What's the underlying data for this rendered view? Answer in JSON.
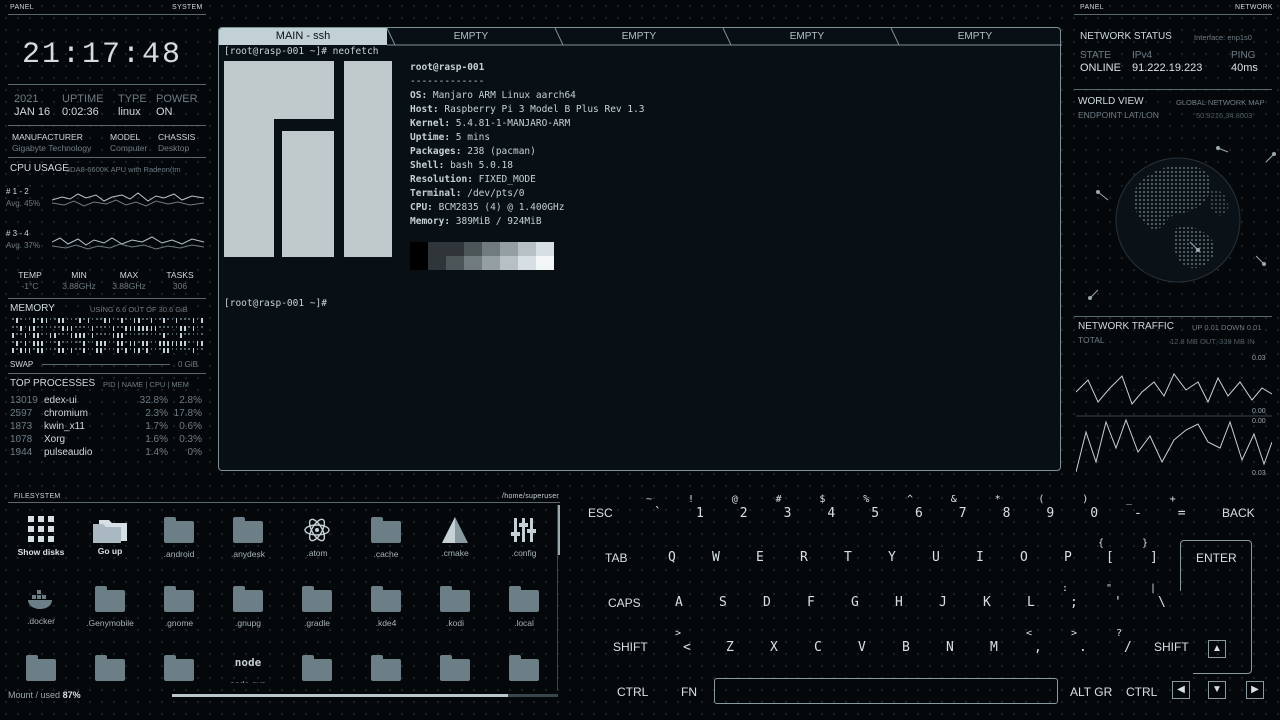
{
  "left_panel": {
    "header_left": "PANEL",
    "header_right": "SYSTEM",
    "clock": "21:17:48",
    "sysinfo": {
      "year": "2021",
      "date": "JAN 16",
      "uptime_label": "UPTIME",
      "uptime": "0:02:36",
      "type_label": "TYPE",
      "type": "linux",
      "power_label": "POWER",
      "power": "ON"
    },
    "hardware": {
      "manufacturer_label": "MANUFACTURER",
      "manufacturer": "Gigabyte Technology",
      "model_label": "MODEL",
      "model": "Computer",
      "chassis_label": "CHASSIS",
      "chassis": "Desktop"
    },
    "cpu": {
      "title": "CPU USAGE",
      "model": "3DA8-6600K APU with Radeon(tm",
      "group1_label": "# 1 - 2",
      "group1_avg": "Avg. 45%",
      "group2_label": "# 3 - 4",
      "group2_avg": "Avg. 37%",
      "temp_label": "TEMP",
      "temp": "-1°C",
      "min_label": "MIN",
      "min": "3.88GHz",
      "max_label": "MAX",
      "max": "3.88GHz",
      "tasks_label": "TASKS",
      "tasks": "306"
    },
    "memory": {
      "title": "MEMORY",
      "usage": "USING 6.6 OUT OF 30.6 GiB",
      "swap_label": "SWAP",
      "swap_value": "0 GiB"
    },
    "processes": {
      "title": "TOP PROCESSES",
      "columns": "PID | NAME | CPU | MEM",
      "rows": [
        {
          "pid": "13019",
          "name": "edex-ui",
          "cpu": "32.8%",
          "mem": "2.8%"
        },
        {
          "pid": "2597",
          "name": "chromium",
          "cpu": "2.3%",
          "mem": "17.8%"
        },
        {
          "pid": "1873",
          "name": "kwin_x11",
          "cpu": "1.7%",
          "mem": "0.6%"
        },
        {
          "pid": "1078",
          "name": "Xorg",
          "cpu": "1.6%",
          "mem": "0.3%"
        },
        {
          "pid": "1944",
          "name": "pulseaudio",
          "cpu": "1.4%",
          "mem": "0%"
        }
      ]
    }
  },
  "terminal": {
    "tabs": [
      "MAIN - ssh",
      "EMPTY",
      "EMPTY",
      "EMPTY",
      "EMPTY"
    ],
    "prompt_cmd": "[root@rasp-001 ~]# neofetch",
    "user_host": "root@rasp-001",
    "separator": "-------------",
    "info": [
      {
        "k": "OS:",
        "v": "Manjaro ARM Linux aarch64"
      },
      {
        "k": "Host:",
        "v": "Raspberry Pi 3 Model B Plus Rev 1.3"
      },
      {
        "k": "Kernel:",
        "v": "5.4.81-1-MANJARO-ARM"
      },
      {
        "k": "Uptime:",
        "v": "5 mins"
      },
      {
        "k": "Packages:",
        "v": "238 (pacman)"
      },
      {
        "k": "Shell:",
        "v": "bash 5.0.18"
      },
      {
        "k": "Resolution:",
        "v": "FIXED_MODE"
      },
      {
        "k": "Terminal:",
        "v": "/dev/pts/0"
      },
      {
        "k": "CPU:",
        "v": "BCM2835 (4) @ 1.400GHz"
      },
      {
        "k": "Memory:",
        "v": "389MiB / 924MiB"
      }
    ],
    "prompt_end": "[root@rasp-001 ~]#",
    "palette": [
      "#000000",
      "#2f3538",
      "#4c5659",
      "#707b80",
      "#949fa3",
      "#b7c1c5",
      "#d7dfe2",
      "#f2f6f7"
    ]
  },
  "right_panel": {
    "header_left": "PANEL",
    "header_right": "NETWORK",
    "status_title": "NETWORK STATUS",
    "interface": "Interface: enp1s0",
    "state_label": "STATE",
    "state": "ONLINE",
    "ipv4_label": "IPv4",
    "ipv4": "91.222.19.223",
    "ping_label": "PING",
    "ping": "40ms",
    "world_title": "WORLD VIEW",
    "world_sub": "GLOBAL NETWORK MAP",
    "endpoint_label": "ENDPOINT LAT/LON",
    "endpoint_value": "50.9216,34.8003",
    "traffic_title": "NETWORK TRAFFIC",
    "traffic_updown": "UP 0.01 DOWN 0.01",
    "total_label": "TOTAL",
    "total_value": "12.8 MB OUT, 339 MB IN",
    "axis_top": "0.03",
    "axis_mid1": "0.00",
    "axis_mid2": "0.00",
    "axis_bot": "0.03"
  },
  "filesystem": {
    "header_left": "FILESYSTEM",
    "header_right": "/home/superuser",
    "items": [
      "Show disks",
      "Go up",
      ".android",
      ".anydesk",
      ".atom",
      ".cache",
      ".cmake",
      ".config",
      ".docker",
      ".Genymobile",
      ".gnome",
      ".gnupg",
      ".gradle",
      ".kde4",
      ".kodi",
      ".local"
    ],
    "row3_node_label": "node-gyp",
    "mount_label": "Mount",
    "used_label": "/ used",
    "used_value": "87%",
    "used_fraction": 0.87
  },
  "keyboard": {
    "row1": [
      {
        "k": "1",
        "s": "!"
      },
      {
        "k": "2",
        "s": "@"
      },
      {
        "k": "3",
        "s": "#"
      },
      {
        "k": "4",
        "s": "$"
      },
      {
        "k": "5",
        "s": "%"
      },
      {
        "k": "6",
        "s": "^"
      },
      {
        "k": "7",
        "s": "&"
      },
      {
        "k": "8",
        "s": "*"
      },
      {
        "k": "9",
        "s": "("
      },
      {
        "k": "0",
        "s": ")"
      },
      {
        "k": "-",
        "s": "_"
      },
      {
        "k": "=",
        "s": "+"
      }
    ],
    "row1_first": {
      "k": "`",
      "s": "~"
    },
    "row2": [
      "Q",
      "W",
      "E",
      "R",
      "T",
      "Y",
      "U",
      "I",
      "O",
      "P"
    ],
    "row2_br": [
      {
        "k": "[",
        "s": "{"
      },
      {
        "k": "]",
        "s": "}"
      }
    ],
    "row3": [
      "A",
      "S",
      "D",
      "F",
      "G",
      "H",
      "J",
      "K",
      "L"
    ],
    "row3_extra": [
      {
        "k": ";",
        "s": ":"
      },
      {
        "k": "'",
        "s": "\""
      },
      {
        "k": "\\",
        "s": "|"
      }
    ],
    "row4": [
      "Z",
      "X",
      "C",
      "V",
      "B",
      "N",
      "M"
    ],
    "row4_extra": [
      {
        "k": ",",
        "s": "<"
      },
      {
        "k": ".",
        "s": ">"
      },
      {
        "k": "/",
        "s": "?"
      }
    ],
    "row4_first": {
      "k": "<",
      "s": ">"
    },
    "esc": "ESC",
    "back": "BACK",
    "tab": "TAB",
    "enter": "ENTER",
    "caps": "CAPS",
    "shift": "SHIFT",
    "ctrl": "CTRL",
    "fn": "FN",
    "altgr": "ALT GR"
  }
}
